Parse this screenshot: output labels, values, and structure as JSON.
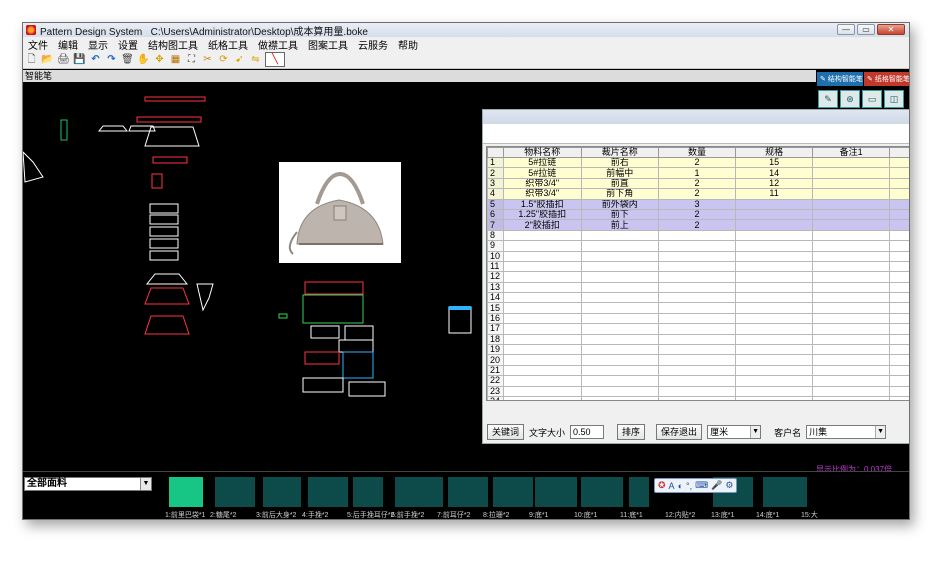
{
  "window": {
    "app_name": "Pattern Design System",
    "file_path": "C:\\Users\\Administrator\\Desktop\\成本算用量.boke",
    "controls": [
      "—",
      "▭",
      "✕"
    ]
  },
  "menu": [
    "文件",
    "编辑",
    "显示",
    "设置",
    "结构图工具",
    "纸格工具",
    "做襟工具",
    "图案工具",
    "云服务",
    "帮助"
  ],
  "toolbar": {
    "icons": [
      "new-file-icon",
      "open-folder-icon",
      "print-icon",
      "save-icon",
      "undo-icon",
      "redo-icon",
      "delete-icon",
      "hand-icon",
      "move-icon",
      "measure-icon",
      "crop-icon",
      "scissors-icon",
      "rotate-icon",
      "arrow-icon",
      "flip-icon",
      "line-tool-icon"
    ],
    "glyphs": [
      "🗋",
      "📂",
      "🖨",
      "💾",
      "↶",
      "↷",
      "🗑",
      "✋",
      "✥",
      "▦",
      "⛶",
      "✂",
      "⟳",
      "➹",
      "⇋",
      "╲"
    ]
  },
  "mode_label": "智能笔",
  "right_panel": {
    "btn_structure": "结构智能笔",
    "btn_pattern": "纸格智能笔",
    "tools": [
      "✎",
      "⊛",
      "▭",
      "◫"
    ]
  },
  "scale_text": "显示比例为：0.037倍",
  "grid": {
    "headers": [
      "",
      "物料名称",
      "裁片名称",
      "数量",
      "规格",
      "备注1"
    ],
    "rows": [
      {
        "n": "1",
        "material": "5#拉链",
        "piece": "前右",
        "qty": "2",
        "spec": "15",
        "note": "",
        "style": "y"
      },
      {
        "n": "2",
        "material": "5#拉链",
        "piece": "前幅中",
        "qty": "1",
        "spec": "14",
        "note": "",
        "style": "y"
      },
      {
        "n": "3",
        "material": "织带3/4\"",
        "piece": "前直",
        "qty": "2",
        "spec": "12",
        "note": "",
        "style": "y"
      },
      {
        "n": "4",
        "material": "织带3/4\"",
        "piece": "前下角",
        "qty": "2",
        "spec": "11",
        "note": "",
        "style": "y"
      },
      {
        "n": "5",
        "material": "1.5\"胶插扣",
        "piece": "前外袋内",
        "qty": "3",
        "spec": "",
        "note": "",
        "style": "p"
      },
      {
        "n": "6",
        "material": "1.25\"胶插扣",
        "piece": "前下",
        "qty": "2",
        "spec": "",
        "note": "",
        "style": "p"
      },
      {
        "n": "7",
        "material": "2\"胶插扣",
        "piece": "前上",
        "qty": "2",
        "spec": "",
        "note": "",
        "style": "p"
      },
      {
        "n": "8",
        "material": "",
        "piece": "",
        "qty": "",
        "spec": "",
        "note": "",
        "style": "e"
      },
      {
        "n": "9",
        "material": "",
        "piece": "",
        "qty": "",
        "spec": "",
        "note": "",
        "style": "e"
      },
      {
        "n": "10",
        "material": "",
        "piece": "",
        "qty": "",
        "spec": "",
        "note": "",
        "style": "e"
      },
      {
        "n": "11",
        "material": "",
        "piece": "",
        "qty": "",
        "spec": "",
        "note": "",
        "style": "e"
      },
      {
        "n": "12",
        "material": "",
        "piece": "",
        "qty": "",
        "spec": "",
        "note": "",
        "style": "e"
      },
      {
        "n": "13",
        "material": "",
        "piece": "",
        "qty": "",
        "spec": "",
        "note": "",
        "style": "e"
      },
      {
        "n": "14",
        "material": "",
        "piece": "",
        "qty": "",
        "spec": "",
        "note": "",
        "style": "e"
      },
      {
        "n": "15",
        "material": "",
        "piece": "",
        "qty": "",
        "spec": "",
        "note": "",
        "style": "e"
      },
      {
        "n": "16",
        "material": "",
        "piece": "",
        "qty": "",
        "spec": "",
        "note": "",
        "style": "e"
      },
      {
        "n": "17",
        "material": "",
        "piece": "",
        "qty": "",
        "spec": "",
        "note": "",
        "style": "e"
      },
      {
        "n": "18",
        "material": "",
        "piece": "",
        "qty": "",
        "spec": "",
        "note": "",
        "style": "e"
      },
      {
        "n": "19",
        "material": "",
        "piece": "",
        "qty": "",
        "spec": "",
        "note": "",
        "style": "e"
      },
      {
        "n": "20",
        "material": "",
        "piece": "",
        "qty": "",
        "spec": "",
        "note": "",
        "style": "e"
      },
      {
        "n": "21",
        "material": "",
        "piece": "",
        "qty": "",
        "spec": "",
        "note": "",
        "style": "e"
      },
      {
        "n": "22",
        "material": "",
        "piece": "",
        "qty": "",
        "spec": "",
        "note": "",
        "style": "e"
      },
      {
        "n": "23",
        "material": "",
        "piece": "",
        "qty": "",
        "spec": "",
        "note": "",
        "style": "e"
      },
      {
        "n": "24",
        "material": "",
        "piece": "",
        "qty": "",
        "spec": "",
        "note": "",
        "style": "e"
      }
    ]
  },
  "dialog_bottom": {
    "keyword_button": "关键词",
    "font_size_label": "文字大小",
    "font_size_value": "0.50",
    "sort_button": "排序",
    "save_exit_button": "保存退出",
    "unit_value": "厘米",
    "customer_label": "客户名",
    "customer_value": "川集"
  },
  "bottom_bar": {
    "fabric_select": "全部面料",
    "piece_labels": [
      "1:前里巴袋*1",
      "2:糖尾*2",
      "3:前后大身*2",
      "4:手挽*2",
      "5:后手挽耳仔*2",
      "6:前手挽*2",
      "7:前耳仔*2",
      "8:拉珊*2",
      "9:底*1",
      "10:底*1",
      "11:底*1",
      "12:内贴*2",
      "13:底*1",
      "14:底*1",
      "15:大"
    ],
    "ime_items": [
      "A",
      "◐",
      "°,",
      "⌨",
      "🎤",
      "⚙"
    ]
  }
}
